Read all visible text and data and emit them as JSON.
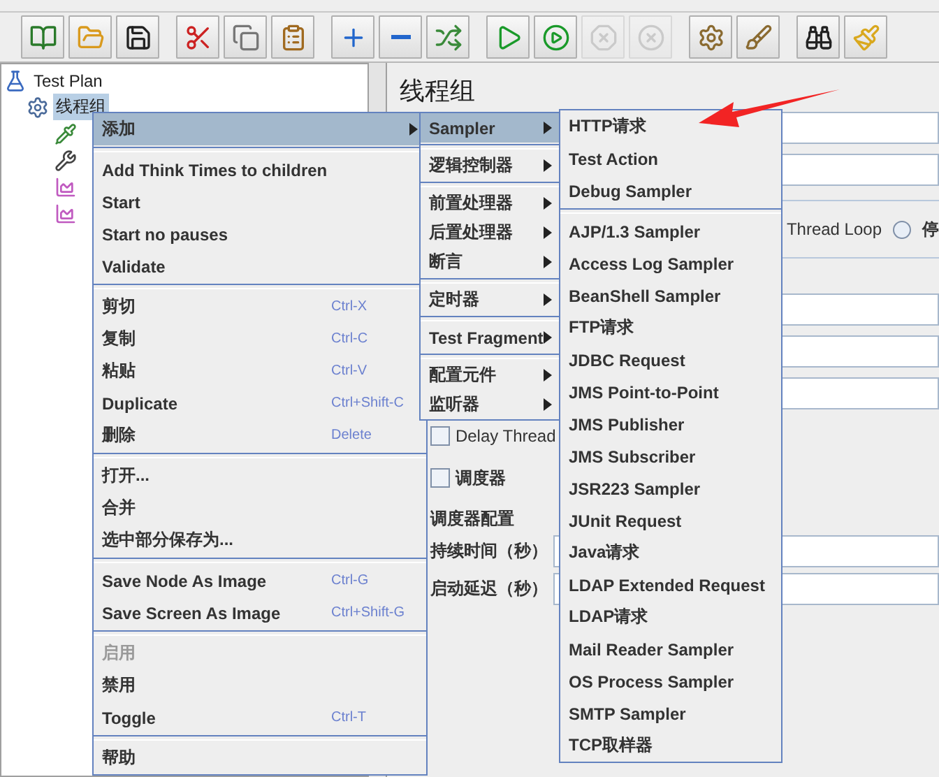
{
  "toolbar": [
    [
      {
        "disabled": false
      },
      {
        "disabled": false
      },
      {
        "disabled": false
      }
    ],
    [
      {
        "disabled": false
      },
      {
        "disabled": false
      },
      {
        "disabled": false
      }
    ],
    [
      {
        "disabled": false
      },
      {
        "disabled": false
      },
      {
        "disabled": false
      }
    ],
    [
      {
        "disabled": false
      },
      {
        "disabled": false
      },
      {
        "disabled": true
      },
      {
        "disabled": true
      }
    ],
    [
      {
        "disabled": false
      },
      {
        "disabled": false
      }
    ],
    [
      {
        "disabled": false
      },
      {
        "disabled": false
      }
    ]
  ],
  "tree": {
    "label": "Test Plan",
    "kind": "plan",
    "children": [
      {
        "label": "线程组",
        "kind": "thread-group",
        "selected": true,
        "children": [
          {
            "kind": "pipette"
          },
          {
            "kind": "tools"
          },
          {
            "kind": "graph"
          },
          {
            "kind": "graph"
          }
        ]
      }
    ]
  },
  "panel": {
    "title": "线程组",
    "thread_loop": {
      "label": "Thread Loop",
      "radio_text": "停",
      "selected": false
    },
    "delay_thread": {
      "label": "Delay Thread",
      "checked": false
    },
    "scheduler": {
      "label": "调度器",
      "checked": false
    },
    "scheduler_config": {
      "title": "调度器配置",
      "fields": [
        {
          "label": "持续时间（秒）"
        },
        {
          "label": "启动延迟（秒）"
        }
      ]
    }
  },
  "context_menu": [
    [
      {
        "label": "添加",
        "selected": true,
        "disabled": false,
        "submenu": true
      }
    ],
    [
      {
        "label": "Add Think Times to children",
        "selected": false,
        "disabled": false
      },
      {
        "label": "Start",
        "selected": false,
        "disabled": false
      },
      {
        "label": "Start no pauses",
        "selected": false,
        "disabled": false
      },
      {
        "label": "Validate",
        "selected": false,
        "disabled": false
      }
    ],
    [
      {
        "label": "剪切",
        "shortcut": "Ctrl-X",
        "selected": false,
        "disabled": false
      },
      {
        "label": "复制",
        "shortcut": "Ctrl-C",
        "selected": false,
        "disabled": false
      },
      {
        "label": "粘贴",
        "shortcut": "Ctrl-V",
        "selected": false,
        "disabled": false
      },
      {
        "label": "Duplicate",
        "shortcut": "Ctrl+Shift-C",
        "selected": false,
        "disabled": false
      },
      {
        "label": "删除",
        "shortcut": "Delete",
        "selected": false,
        "disabled": false
      }
    ],
    [
      {
        "label": "打开...",
        "selected": false,
        "disabled": false
      },
      {
        "label": "合并",
        "selected": false,
        "disabled": false
      },
      {
        "label": "选中部分保存为...",
        "selected": false,
        "disabled": false
      }
    ],
    [
      {
        "label": "Save Node As Image",
        "shortcut": "Ctrl-G",
        "selected": false,
        "disabled": false
      },
      {
        "label": "Save Screen As Image",
        "shortcut": "Ctrl+Shift-G",
        "selected": false,
        "disabled": false
      }
    ],
    [
      {
        "label": "启用",
        "selected": false,
        "disabled": true
      },
      {
        "label": "禁用",
        "selected": false,
        "disabled": false
      },
      {
        "label": "Toggle",
        "shortcut": "Ctrl-T",
        "selected": false,
        "disabled": false
      }
    ],
    [
      {
        "label": "帮助",
        "selected": false,
        "disabled": false
      }
    ]
  ],
  "add_submenu": [
    [
      {
        "label": "Sampler",
        "selected": true,
        "submenu": true
      }
    ],
    [
      {
        "label": "逻辑控制器",
        "selected": false,
        "submenu": true
      }
    ],
    [
      {
        "label": "前置处理器",
        "selected": false,
        "submenu": true
      },
      {
        "label": "后置处理器",
        "selected": false,
        "submenu": true
      },
      {
        "label": "断言",
        "selected": false,
        "submenu": true
      }
    ],
    [
      {
        "label": "定时器",
        "selected": false,
        "submenu": true
      }
    ],
    [
      {
        "label": "Test Fragment",
        "selected": false,
        "submenu": true
      }
    ],
    [
      {
        "label": "配置元件",
        "selected": false,
        "submenu": true
      },
      {
        "label": "监听器",
        "selected": false,
        "submenu": true
      }
    ]
  ],
  "sampler_submenu": [
    [
      {
        "label": "HTTP请求",
        "selected": false
      },
      {
        "label": "Test Action",
        "selected": false
      },
      {
        "label": "Debug Sampler",
        "selected": false
      }
    ],
    [
      {
        "label": "AJP/1.3 Sampler",
        "selected": false
      },
      {
        "label": "Access Log Sampler",
        "selected": false
      },
      {
        "label": "BeanShell Sampler",
        "selected": false
      },
      {
        "label": "FTP请求",
        "selected": false
      },
      {
        "label": "JDBC Request",
        "selected": false
      },
      {
        "label": "JMS Point-to-Point",
        "selected": false
      },
      {
        "label": "JMS Publisher",
        "selected": false
      },
      {
        "label": "JMS Subscriber",
        "selected": false
      },
      {
        "label": "JSR223 Sampler",
        "selected": false
      },
      {
        "label": "JUnit Request",
        "selected": false
      },
      {
        "label": "Java请求",
        "selected": false
      },
      {
        "label": "LDAP Extended Request",
        "selected": false
      },
      {
        "label": "LDAP请求",
        "selected": false
      },
      {
        "label": "Mail Reader Sampler",
        "selected": false
      },
      {
        "label": "OS Process Sampler",
        "selected": false
      },
      {
        "label": "SMTP Sampler",
        "selected": false
      },
      {
        "label": "TCP取样器",
        "selected": false
      }
    ]
  ]
}
